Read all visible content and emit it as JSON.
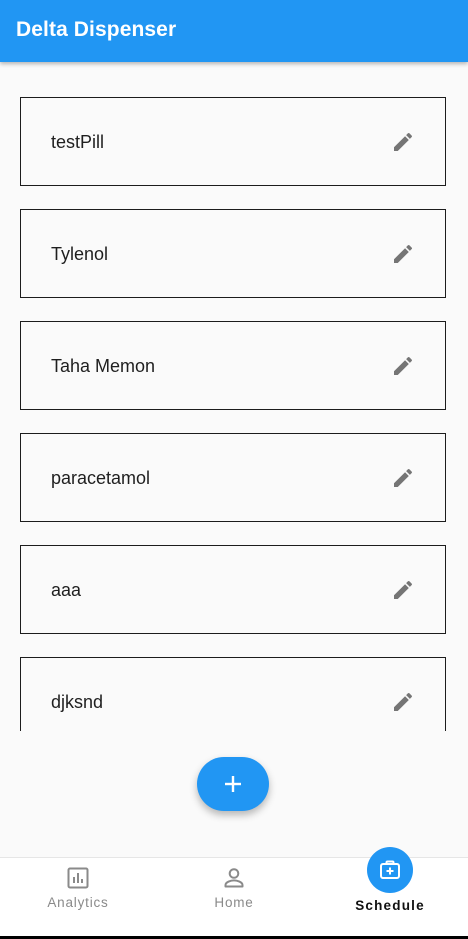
{
  "app_bar": {
    "title": "Delta Dispenser",
    "color": "#2196f3"
  },
  "pills": [
    {
      "name": "testPill",
      "edit_icon": "edit-icon"
    },
    {
      "name": "Tylenol",
      "edit_icon": "edit-icon"
    },
    {
      "name": "Taha Memon",
      "edit_icon": "edit-icon"
    },
    {
      "name": "paracetamol",
      "edit_icon": "edit-icon"
    },
    {
      "name": "aaa",
      "edit_icon": "edit-icon"
    },
    {
      "name": "djksnd",
      "edit_icon": "edit-icon"
    }
  ],
  "fab": {
    "icon": "plus-icon",
    "color": "#2196f3"
  },
  "bottom_nav": {
    "items": [
      {
        "label": "Analytics",
        "icon": "analytics-icon",
        "active": false
      },
      {
        "label": "Home",
        "icon": "person-icon",
        "active": false
      },
      {
        "label": "Schedule",
        "icon": "medical-kit-icon",
        "active": true
      }
    ]
  }
}
